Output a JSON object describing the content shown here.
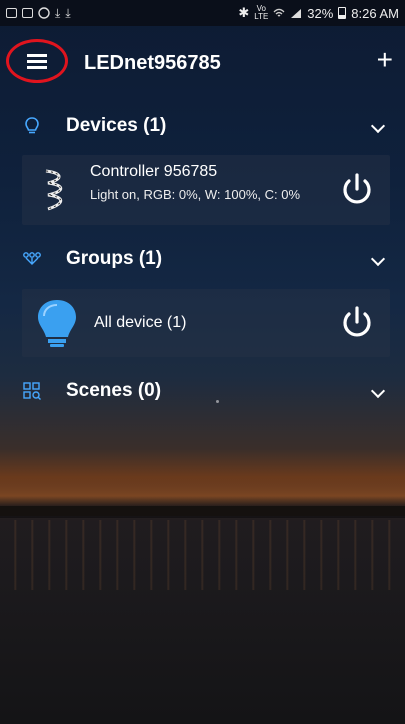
{
  "status_bar": {
    "icons_left": [
      "mail-icon",
      "image-icon",
      "whatsapp-icon",
      "download-icon",
      "download-icon"
    ],
    "icons_right": [
      "bluetooth-icon",
      "volte-icon",
      "wifi-icon",
      "signal-icon",
      "battery-icon"
    ],
    "volte": "Vo LTE",
    "battery": "32%",
    "time": "8:26 AM"
  },
  "appbar": {
    "title": "LEDnet956785",
    "add_label": "+",
    "menu_icon": "hamburger-menu-icon",
    "menu_highlight_color": "#e0141e"
  },
  "sections": {
    "devices": {
      "label": "Devices (1)",
      "icon": "lightbulb-outline-icon"
    },
    "groups": {
      "label": "Groups (1)",
      "icon": "group-icon"
    },
    "scenes": {
      "label": "Scenes (0)",
      "icon": "scenes-grid-icon"
    }
  },
  "device": {
    "name": "Controller  956785",
    "status": "Light on, RGB: 0%, W: 100%, C: 0%",
    "icon": "led-strip-icon"
  },
  "group": {
    "name": "All device (1)",
    "icon": "lightbulb-filled-icon"
  },
  "accent_color": "#47a8ff"
}
